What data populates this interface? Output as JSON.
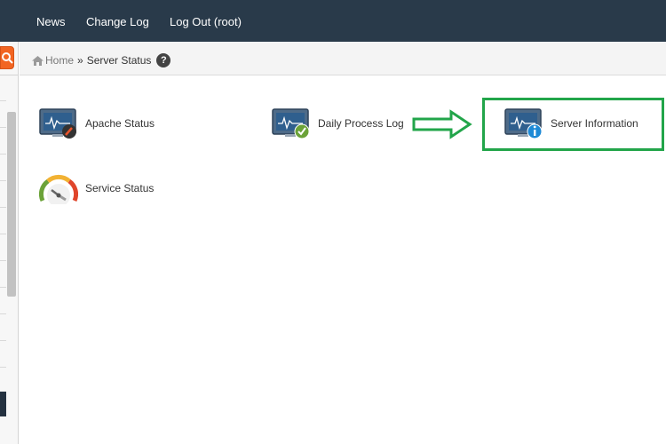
{
  "nav": {
    "news": "News",
    "change_log": "Change Log",
    "logout": "Log Out (root)"
  },
  "breadcrumb": {
    "home": "Home",
    "separator": "»",
    "current": "Server Status",
    "help": "?"
  },
  "tiles": {
    "apache": {
      "label": "Apache Status",
      "icon": "monitor-gauge-icon"
    },
    "daily": {
      "label": "Daily Process Log",
      "icon": "monitor-check-icon"
    },
    "server": {
      "label": "Server Information",
      "icon": "monitor-info-icon"
    },
    "service": {
      "label": "Service Status",
      "icon": "speedometer-icon"
    }
  },
  "colors": {
    "navbar": "#293a4a",
    "accent_orange": "#f26522",
    "highlight_green": "#22a54a"
  }
}
